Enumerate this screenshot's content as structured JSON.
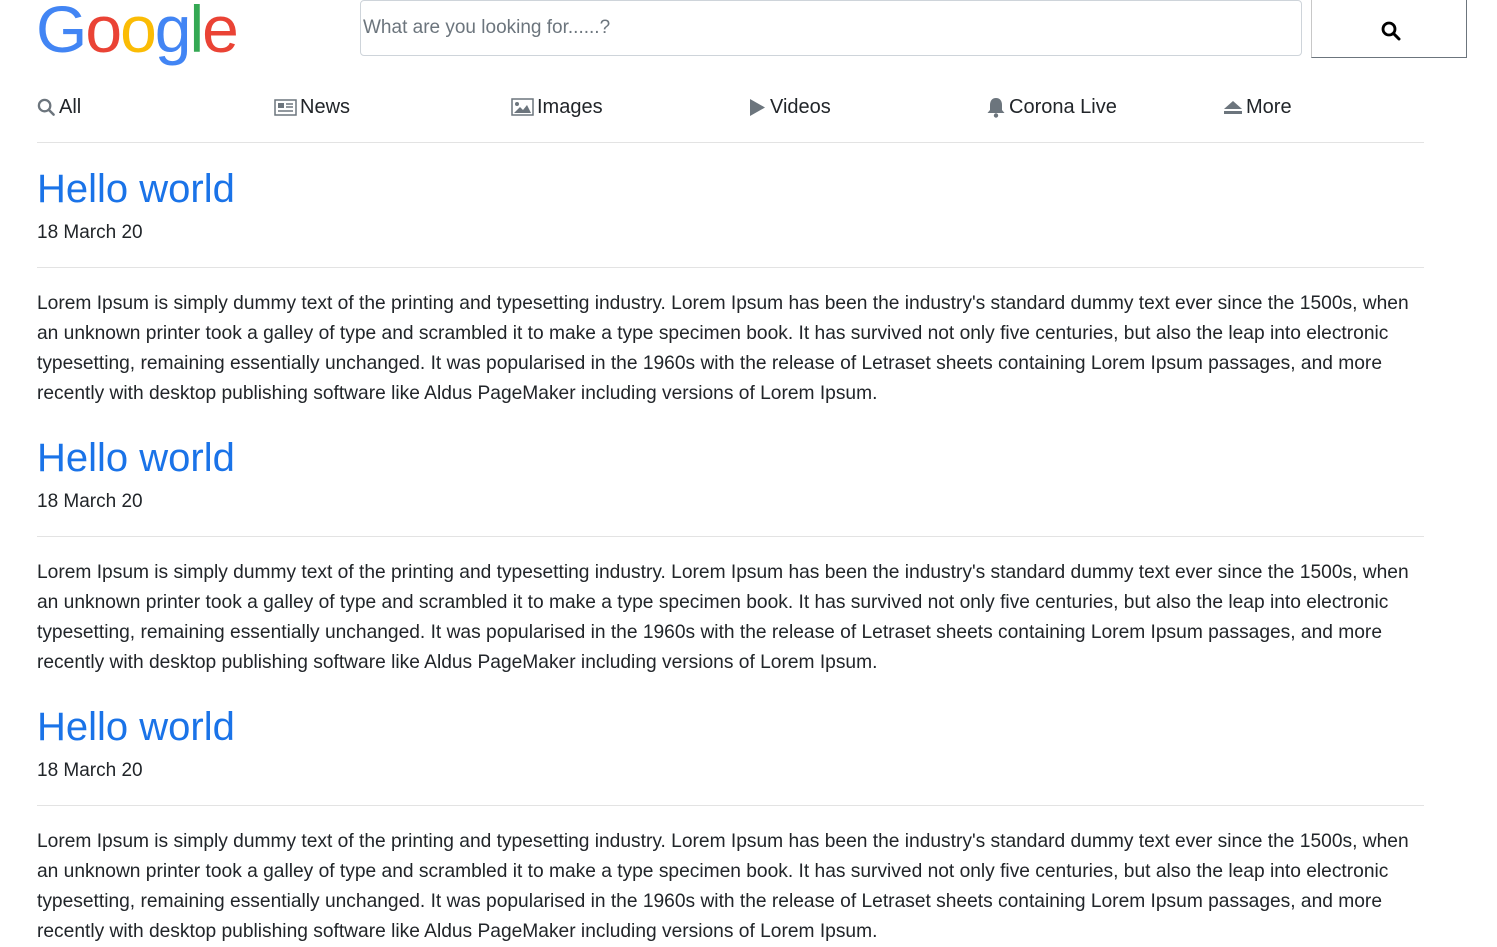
{
  "logo": {
    "letters": [
      "G",
      "o",
      "o",
      "g",
      "l",
      "e"
    ],
    "colors": [
      "#4285F4",
      "#EA4335",
      "#FBBC05",
      "#4285F4",
      "#34A853",
      "#EA4335"
    ]
  },
  "search": {
    "placeholder": "What are you looking for......?",
    "value": "",
    "button_icon": "search-icon"
  },
  "nav": {
    "items": [
      {
        "label": "All",
        "icon": "search-icon"
      },
      {
        "label": "News",
        "icon": "newspaper-icon"
      },
      {
        "label": "Images",
        "icon": "image-icon"
      },
      {
        "label": "Videos",
        "icon": "play-icon"
      },
      {
        "label": "Corona Live",
        "icon": "bell-icon"
      },
      {
        "label": "More",
        "icon": "eject-icon"
      }
    ]
  },
  "results": [
    {
      "title": "Hello world",
      "date": "18 March 20",
      "body": "Lorem Ipsum is simply dummy text of the printing and typesetting industry. Lorem Ipsum has been the industry's standard dummy text ever since the 1500s, when an unknown printer took a galley of type and scrambled it to make a type specimen book. It has survived not only five centuries, but also the leap into electronic typesetting, remaining essentially unchanged. It was popularised in the 1960s with the release of Letraset sheets containing Lorem Ipsum passages, and more recently with desktop publishing software like Aldus PageMaker including versions of Lorem Ipsum."
    },
    {
      "title": "Hello world",
      "date": "18 March 20",
      "body": "Lorem Ipsum is simply dummy text of the printing and typesetting industry. Lorem Ipsum has been the industry's standard dummy text ever since the 1500s, when an unknown printer took a galley of type and scrambled it to make a type specimen book. It has survived not only five centuries, but also the leap into electronic typesetting, remaining essentially unchanged. It was popularised in the 1960s with the release of Letraset sheets containing Lorem Ipsum passages, and more recently with desktop publishing software like Aldus PageMaker including versions of Lorem Ipsum."
    },
    {
      "title": "Hello world",
      "date": "18 March 20",
      "body": "Lorem Ipsum is simply dummy text of the printing and typesetting industry. Lorem Ipsum has been the industry's standard dummy text ever since the 1500s, when an unknown printer took a galley of type and scrambled it to make a type specimen book. It has survived not only five centuries, but also the leap into electronic typesetting, remaining essentially unchanged. It was popularised in the 1960s with the release of Letraset sheets containing Lorem Ipsum passages, and more recently with desktop publishing software like Aldus PageMaker including versions of Lorem Ipsum."
    }
  ],
  "colors": {
    "link": "#1a73e8",
    "text": "#212529",
    "divider": "#e3e3e3"
  }
}
